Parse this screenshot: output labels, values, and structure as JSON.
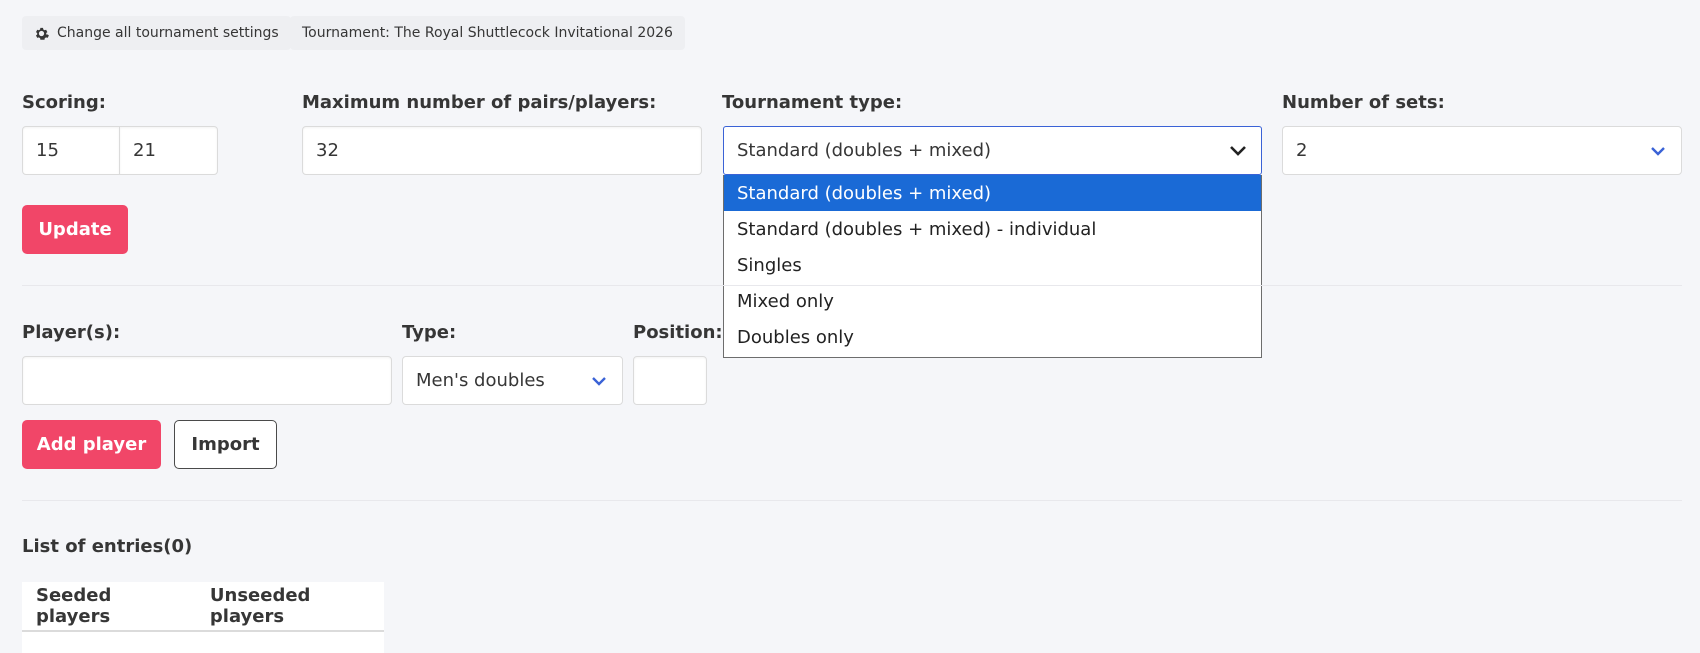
{
  "toolbar": {
    "change_settings_label": "Change all tournament settings",
    "tournament_label": "Tournament: The Royal Shuttlecock Invitational 2026"
  },
  "settings": {
    "scoring_label": "Scoring:",
    "scoring_value_1": "15",
    "scoring_value_2": "21",
    "max_label": "Maximum number of pairs/players:",
    "max_value": "32",
    "type_label": "Tournament type:",
    "type_value": "Standard (doubles + mixed)",
    "type_options": [
      "Standard (doubles + mixed)",
      "Standard (doubles + mixed) - individual",
      "Singles",
      "Mixed only",
      "Doubles only"
    ],
    "sets_label": "Number of sets:",
    "sets_value": "2",
    "update_button": "Update"
  },
  "players": {
    "players_label": "Player(s):",
    "players_value": "",
    "type_label": "Type:",
    "type_value": "Men's doubles",
    "position_label": "Position:",
    "position_value": "",
    "add_button": "Add player",
    "import_button": "Import"
  },
  "entries": {
    "title": "List of entries(0)",
    "columns": [
      "Seeded players",
      "Unseeded players"
    ]
  },
  "colors": {
    "primary": "#f14668",
    "selected_option": "#1a6ad6",
    "chevron": "#3a62d6"
  }
}
